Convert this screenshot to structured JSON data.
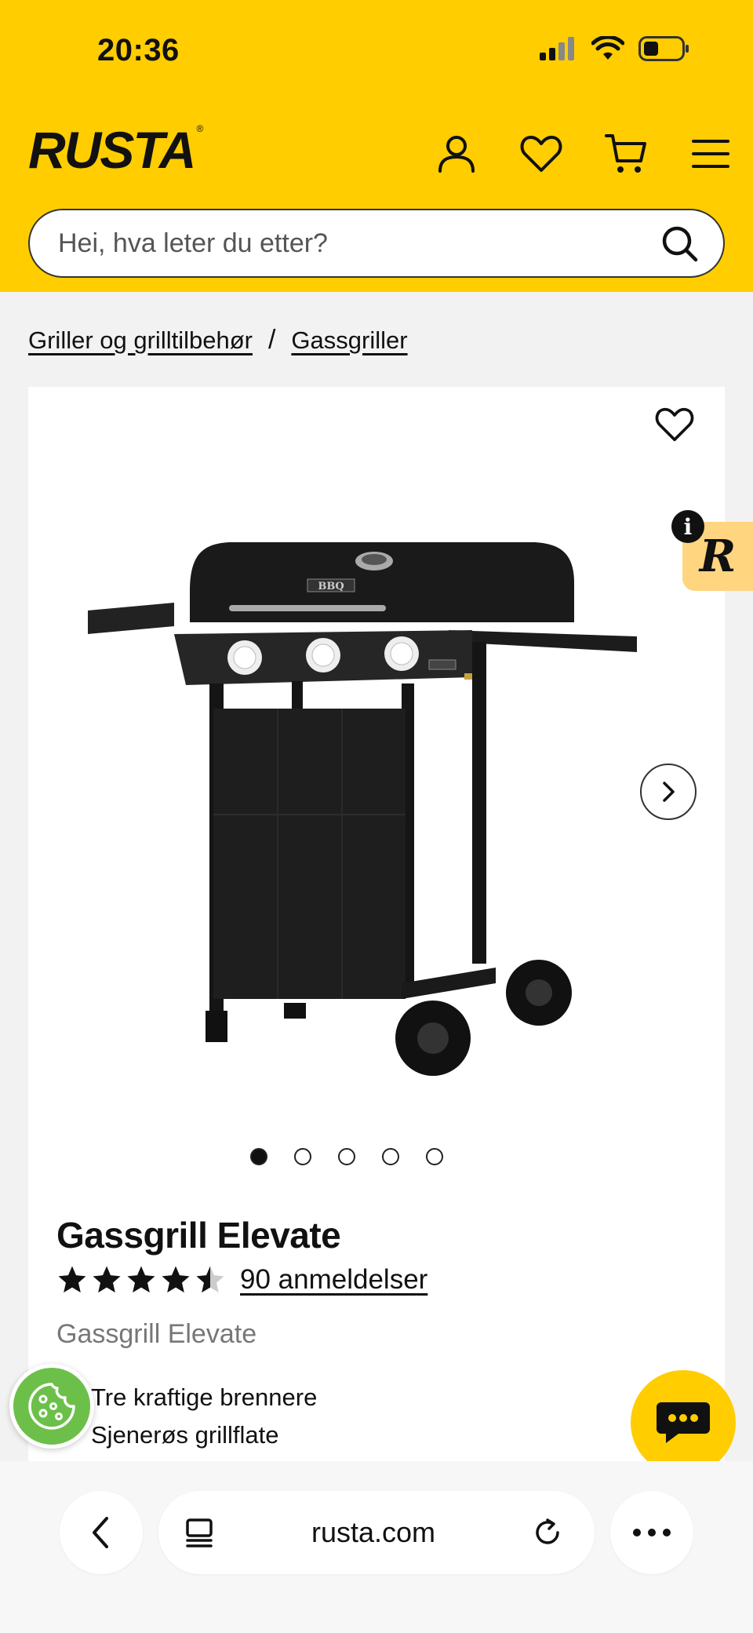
{
  "status_bar": {
    "time": "20:36"
  },
  "header": {
    "logo": "RUSTA",
    "icons": [
      "account-icon",
      "heart-icon",
      "cart-icon",
      "menu-icon"
    ],
    "search": {
      "placeholder": "Hei, hva leter du etter?"
    }
  },
  "breadcrumb": {
    "items": [
      "Griller og grilltilbehør",
      "Gassgriller"
    ],
    "separator": "/"
  },
  "product": {
    "title": "Gassgrill Elevate",
    "rating": 4.5,
    "rating_max": 5,
    "reviews_label": "90 anmeldelser",
    "subtitle": "Gassgrill Elevate",
    "features": [
      "Tre kraftige brennere",
      "Sjenerøs grillflate"
    ],
    "image_count": 5,
    "image_active": 1,
    "grill_label": "BBQ"
  },
  "badge": {
    "letter": "R",
    "info": "i"
  },
  "browser": {
    "url": "rusta.com"
  },
  "colors": {
    "brand_yellow": "#ffcd00",
    "cookie_green": "#6cc04a"
  }
}
